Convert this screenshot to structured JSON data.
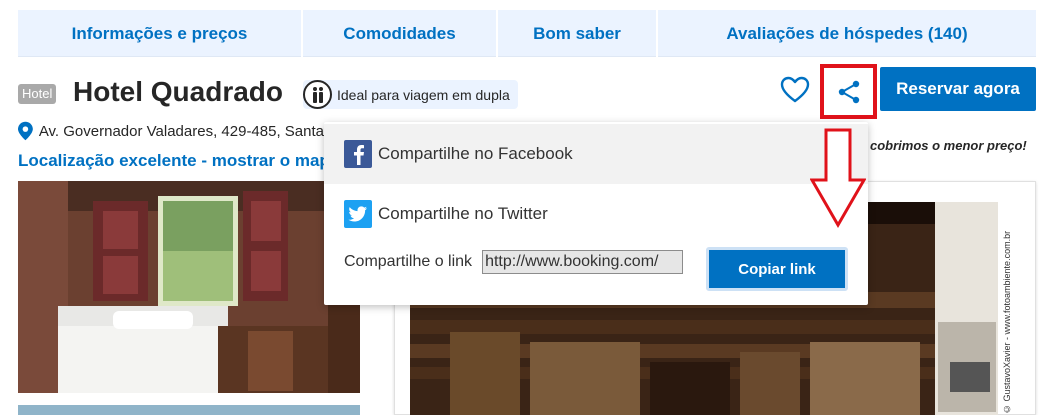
{
  "tabs": [
    {
      "label": "Informações e preços"
    },
    {
      "label": "Comodidades"
    },
    {
      "label": "Bom saber"
    },
    {
      "label": "Avaliações de hóspedes (140)"
    }
  ],
  "header": {
    "badge": "Hotel",
    "hotel_name": "Hotel Quadrado",
    "ideal_label": "Ideal para viagem em dupla",
    "reserve_label": "Reservar agora"
  },
  "address": {
    "text": "Av. Governador Valadares, 429-485, Santa",
    "location_link": "Localização excelente - mostrar o mapa"
  },
  "price_note": "cobrimos o menor preço!",
  "share_menu": {
    "facebook_label": "Compartilhe no Facebook",
    "twitter_label": "Compartilhe no Twitter",
    "link_label": "Compartilhe o link",
    "link_value": "http://www.booking.com/",
    "copy_label": "Copiar link"
  },
  "photo_credit": "© GustavoXavier - www.fotoambiente.com.br",
  "colors": {
    "brand_blue": "#0071c2",
    "tab_bg": "#ebf3ff",
    "highlight_red": "#e0121a",
    "facebook_blue": "#3b5998",
    "twitter_blue": "#1da1f2"
  }
}
